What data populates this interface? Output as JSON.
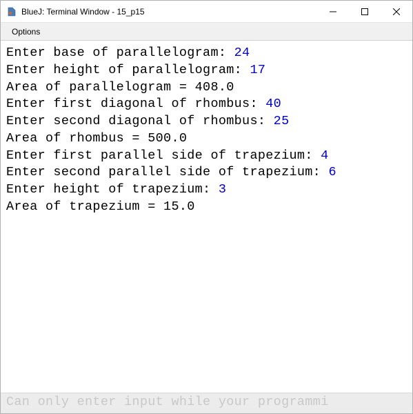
{
  "window": {
    "title": "BlueJ: Terminal Window - 15_p15"
  },
  "menu": {
    "options": "Options"
  },
  "terminal": {
    "lines": [
      {
        "prompt": "Enter base of parallelogram: ",
        "input": "24"
      },
      {
        "prompt": "Enter height of parallelogram: ",
        "input": "17"
      },
      {
        "prompt": "Area of parallelogram = 408.0",
        "input": ""
      },
      {
        "prompt": "Enter first diagonal of rhombus: ",
        "input": "40"
      },
      {
        "prompt": "Enter second diagonal of rhombus: ",
        "input": "25"
      },
      {
        "prompt": "Area of rhombus = 500.0",
        "input": ""
      },
      {
        "prompt": "Enter first parallel side of trapezium: ",
        "input": "4"
      },
      {
        "prompt": "Enter second parallel side of trapezium: ",
        "input": "6"
      },
      {
        "prompt": "Enter height of trapezium: ",
        "input": "3"
      },
      {
        "prompt": "Area of trapezium = 15.0",
        "input": ""
      }
    ]
  },
  "status": {
    "text": "Can only enter input while your programmi"
  }
}
